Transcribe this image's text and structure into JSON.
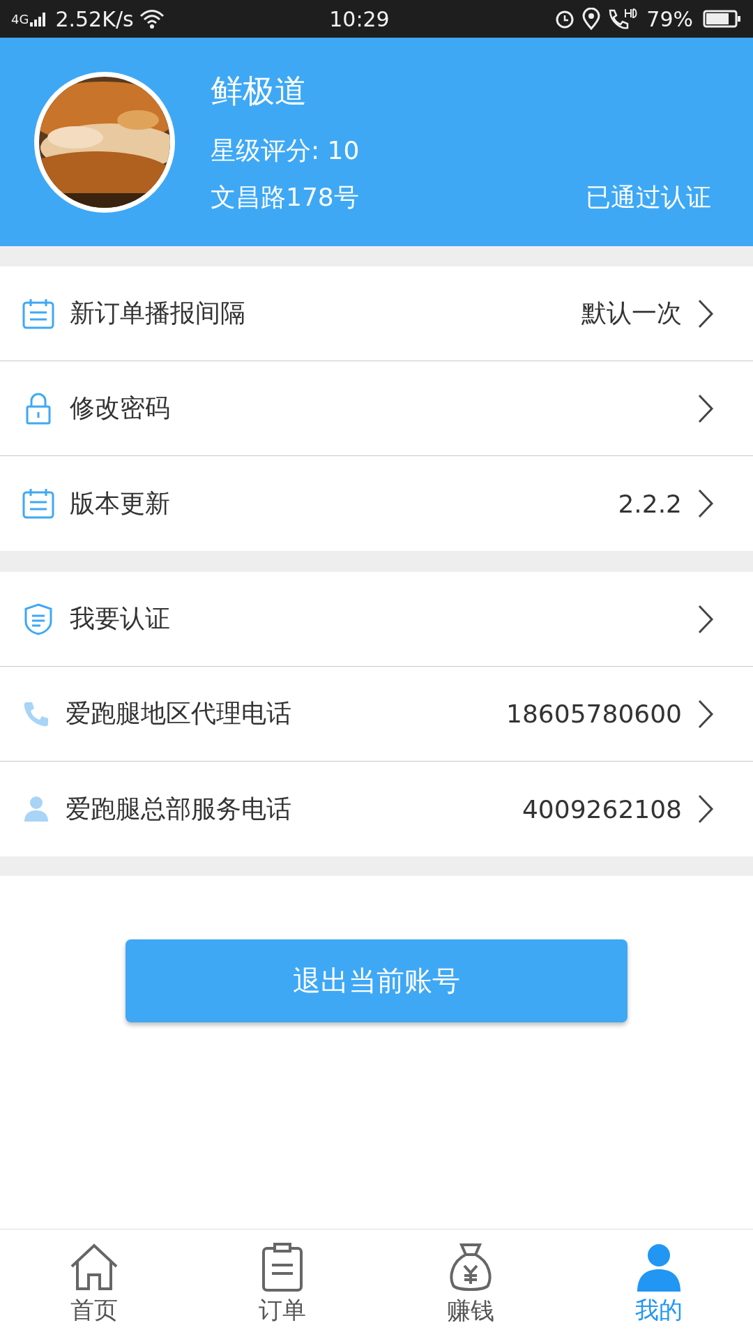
{
  "status_bar": {
    "network": "4G",
    "speed": "2.52K/s",
    "time": "10:29",
    "battery": "79%"
  },
  "profile": {
    "name": "鲜极道",
    "rating": "星级评分: 10",
    "address": "文昌路178号",
    "verified": "已通过认证"
  },
  "sections": [
    {
      "items": [
        {
          "kind": "calendar",
          "label": "新订单播报间隔",
          "value": "默认一次"
        },
        {
          "kind": "lock",
          "label": "修改密码"
        },
        {
          "kind": "calendar",
          "label": "版本更新",
          "value": "2.2.2"
        }
      ]
    },
    {
      "items": [
        {
          "kind": "shield",
          "label": "我要认证"
        },
        {
          "kind": "phone",
          "label": "爱跑腿地区代理电话",
          "value": "18605780600"
        },
        {
          "kind": "person",
          "label": "爱跑腿总部服务电话",
          "value": "4009262108"
        }
      ]
    }
  ],
  "logout_button": "退出当前账号",
  "tabs": [
    {
      "kind": "home",
      "label": "首页",
      "selected": false
    },
    {
      "kind": "clipboard",
      "label": "订单",
      "selected": false
    },
    {
      "kind": "moneybag",
      "label": "赚钱",
      "selected": false
    },
    {
      "kind": "person",
      "label": "我的",
      "selected": true
    }
  ]
}
